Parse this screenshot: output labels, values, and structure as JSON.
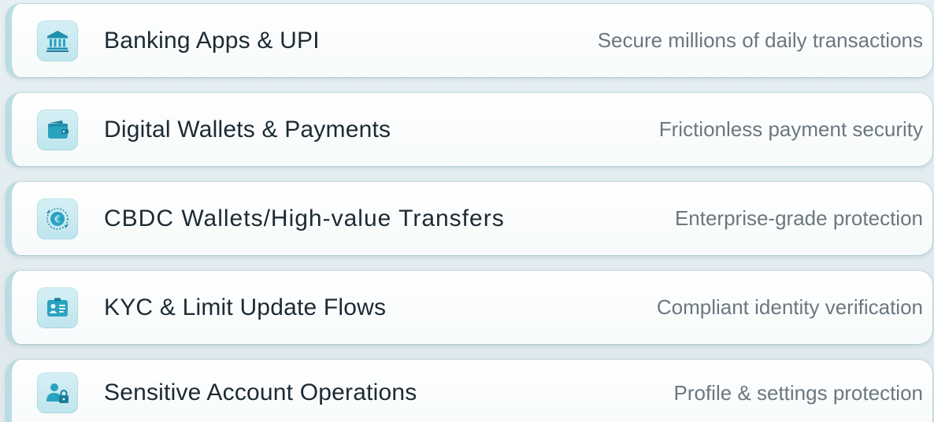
{
  "items": [
    {
      "title": "Banking Apps & UPI",
      "subtitle": "Secure millions of daily transactions",
      "icon": "bank-icon"
    },
    {
      "title": "Digital Wallets & Payments",
      "subtitle": "Frictionless payment security",
      "icon": "wallet-icon"
    },
    {
      "title": "CBDC Wallets/High-value Transfers",
      "subtitle": "Enterprise-grade protection",
      "icon": "euro-coin-icon"
    },
    {
      "title": "KYC & Limit Update Flows",
      "subtitle": "Compliant identity verification",
      "icon": "id-card-icon"
    },
    {
      "title": "Sensitive Account Operations",
      "subtitle": "Profile & settings protection",
      "icon": "user-lock-icon"
    }
  ],
  "colors": {
    "accent": "#2a9fbd",
    "accent_dark": "#1f7f99",
    "title_text": "#1c2a33",
    "subtitle_text": "#6b7780",
    "tile_bg": "#c9eaf1"
  }
}
